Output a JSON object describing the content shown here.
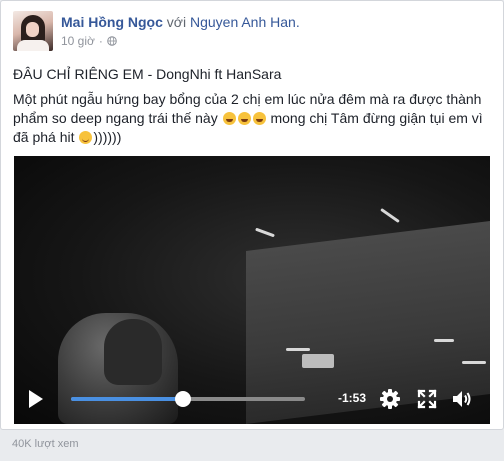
{
  "post": {
    "author": "Mai Hồng Ngọc",
    "with_text": " với ",
    "tagged": "Nguyen Anh Han.",
    "time": "10 giờ",
    "dot": "·",
    "privacy_icon": "globe-icon",
    "title": "ĐÂU CHỈ RIÊNG EM - DongNhi ft HanSara",
    "body_part1": "Một phút ngẫu hứng bay bổng của 2 chị em lúc nửa đêm mà ra được thành phẩm so deep ngang trái thế này ",
    "body_part2": " mong chị Tâm đừng giận tụi em vì đã phá hit ",
    "body_part3": "))))))",
    "emojis": [
      "rolling-on-floor-laughing",
      "rolling-on-floor-laughing",
      "rolling-on-floor-laughing",
      "smiling-face"
    ]
  },
  "video": {
    "progress": 0.48,
    "time_remaining": "-1:53",
    "accent_color": "#4a90e2",
    "icons": [
      "play-icon",
      "settings-icon",
      "fullscreen-icon",
      "volume-icon"
    ]
  },
  "footer": {
    "views": "40K lượt xem"
  }
}
